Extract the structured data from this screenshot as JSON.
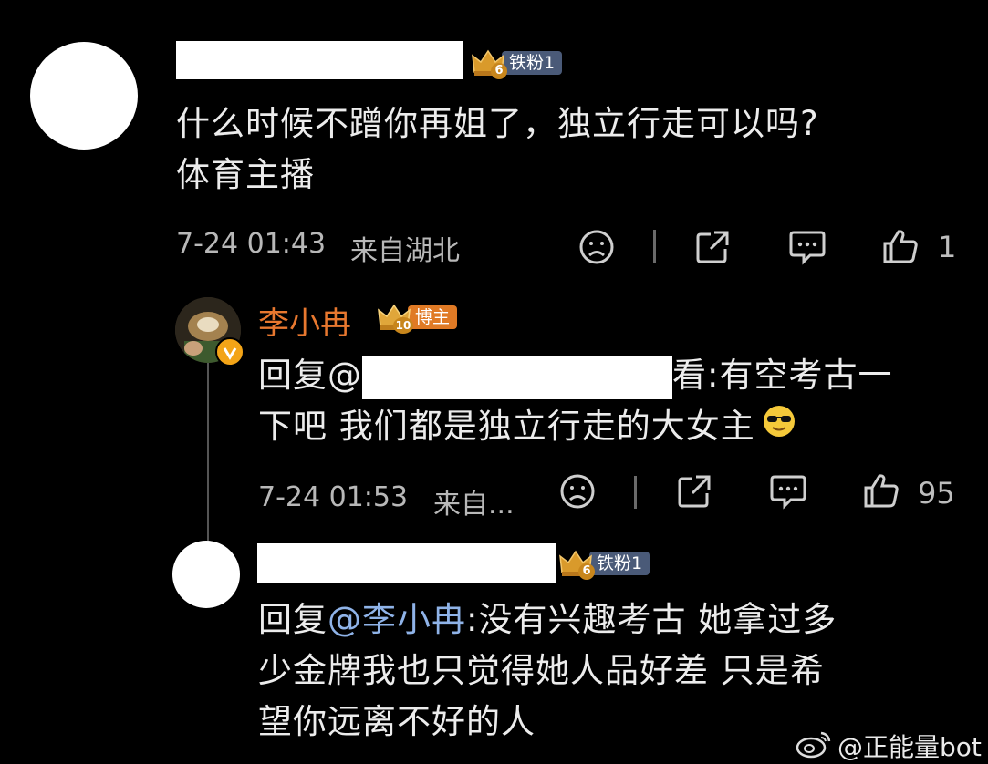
{
  "comment1": {
    "badge_level": "6",
    "badge_label": "铁粉1",
    "text_line1": "什么时候不蹭你再姐了，独立行走可以吗?",
    "text_line2": "体育主播",
    "time": "7-24 01:43",
    "location": "来自湖北",
    "like_count": "1"
  },
  "reply1": {
    "username": "李小冉",
    "badge_level": "10",
    "badge_label": "博主",
    "reply_prefix": "回复@",
    "reply_tail": "看",
    "text_line1": ":有空考古一",
    "text_line2": "下吧 我们都是独立行走的大女主",
    "time": "7-24 01:53",
    "location": "来自...",
    "like_count": "95"
  },
  "reply2": {
    "badge_level": "6",
    "badge_label": "铁粉1",
    "reply_prefix": "回复",
    "mention": "@李小冉",
    "text_line1": ":没有兴趣考古 她拿过多",
    "text_line2": "少金牌我也只觉得她人品好差 只是希",
    "text_line3": "望你远离不好的人"
  },
  "watermark": "@正能量bot",
  "icons": [
    "sad-face-icon",
    "share-icon",
    "comment-icon",
    "thumbs-up-icon",
    "verified-icon",
    "sunglasses-emoji-icon",
    "crown-icon",
    "weibo-logo-icon"
  ]
}
